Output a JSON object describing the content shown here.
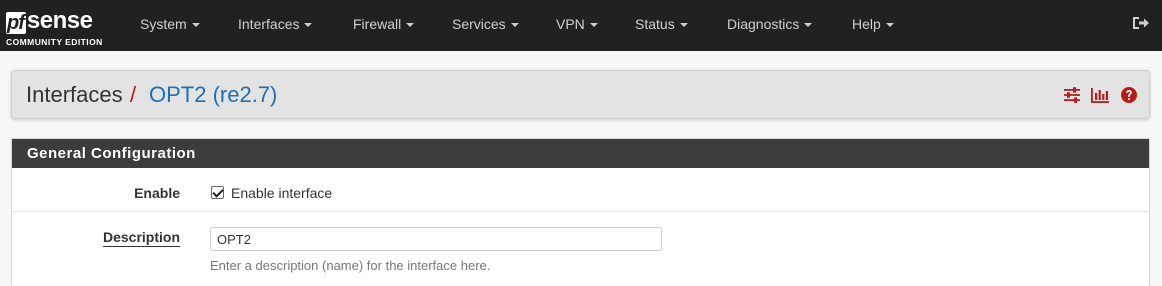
{
  "brand": {
    "logo_pf": "pf",
    "logo_sense": "sense",
    "edition": "COMMUNITY EDITION"
  },
  "nav": {
    "items": [
      {
        "label": "System"
      },
      {
        "label": "Interfaces"
      },
      {
        "label": "Firewall"
      },
      {
        "label": "Services"
      },
      {
        "label": "VPN"
      },
      {
        "label": "Status"
      },
      {
        "label": "Diagnostics"
      },
      {
        "label": "Help"
      }
    ],
    "logout_icon": "sign-out-icon"
  },
  "header": {
    "breadcrumb": {
      "section": "Interfaces",
      "separator": "/",
      "current": "OPT2 (re2.7)"
    },
    "icons": [
      "sliders-icon",
      "bar-chart-icon",
      "question-circle-icon"
    ],
    "accent_color": "#b71c1c",
    "link_color": "#1e6fb5"
  },
  "panel": {
    "title": "General Configuration",
    "enable": {
      "label": "Enable",
      "checkbox_label": "Enable interface",
      "checked": true
    },
    "description": {
      "label": "Description",
      "value": "OPT2",
      "help": "Enter a description (name) for the interface here."
    }
  }
}
